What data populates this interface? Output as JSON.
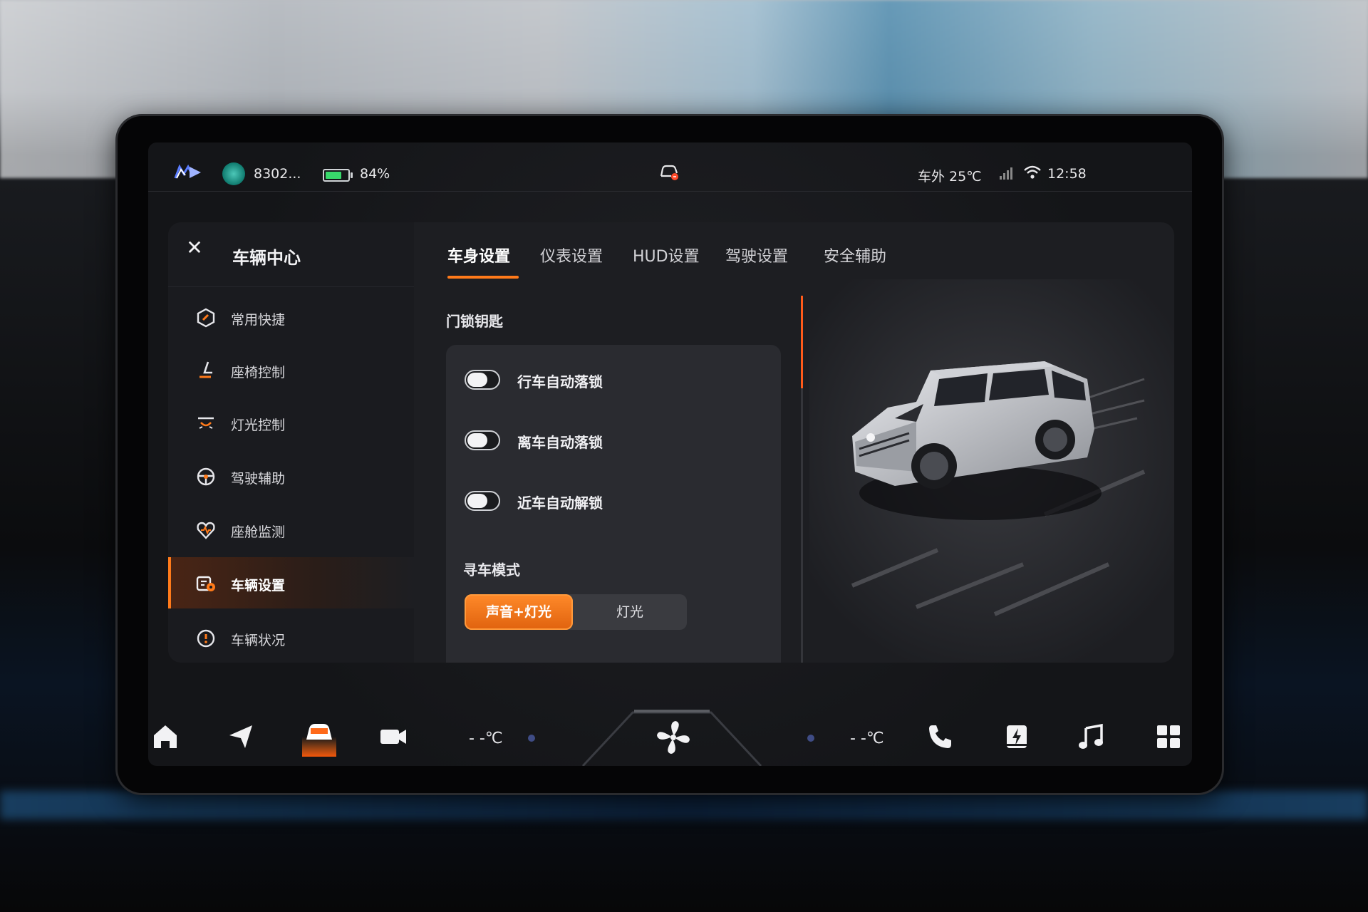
{
  "status_bar": {
    "user_name": "8302...",
    "battery_percent": "84%",
    "battery_level": 0.84,
    "outside_temp": "车外 25℃",
    "time": "12:58"
  },
  "sidebar": {
    "title": "车辆中心",
    "items": [
      {
        "label": "常用快捷",
        "icon": "shortcut-hexagon-icon"
      },
      {
        "label": "座椅控制",
        "icon": "seat-icon"
      },
      {
        "label": "灯光控制",
        "icon": "light-icon"
      },
      {
        "label": "驾驶辅助",
        "icon": "steering-wheel-icon"
      },
      {
        "label": "座舱监测",
        "icon": "cabin-monitor-icon"
      },
      {
        "label": "车辆设置",
        "icon": "vehicle-settings-icon",
        "active": true
      },
      {
        "label": "车辆状况",
        "icon": "vehicle-status-icon"
      }
    ]
  },
  "tabs": [
    {
      "label": "车身设置",
      "active": true
    },
    {
      "label": "仪表设置"
    },
    {
      "label": "HUD设置"
    },
    {
      "label": "驾驶设置"
    },
    {
      "label": "安全辅助"
    }
  ],
  "door_lock": {
    "section_title": "门锁钥匙",
    "toggles": [
      {
        "label": "行车自动落锁",
        "on": false
      },
      {
        "label": "离车自动落锁",
        "on": false
      },
      {
        "label": "近车自动解锁",
        "on": false
      }
    ]
  },
  "find_car": {
    "title": "寻车模式",
    "options": [
      "声音+灯光",
      "灯光"
    ],
    "selected": "声音+灯光"
  },
  "dock": {
    "left_temp": "- -℃",
    "right_temp": "- -℃"
  },
  "colors": {
    "accent": "#ff7a1a",
    "battery": "#38d96b"
  }
}
